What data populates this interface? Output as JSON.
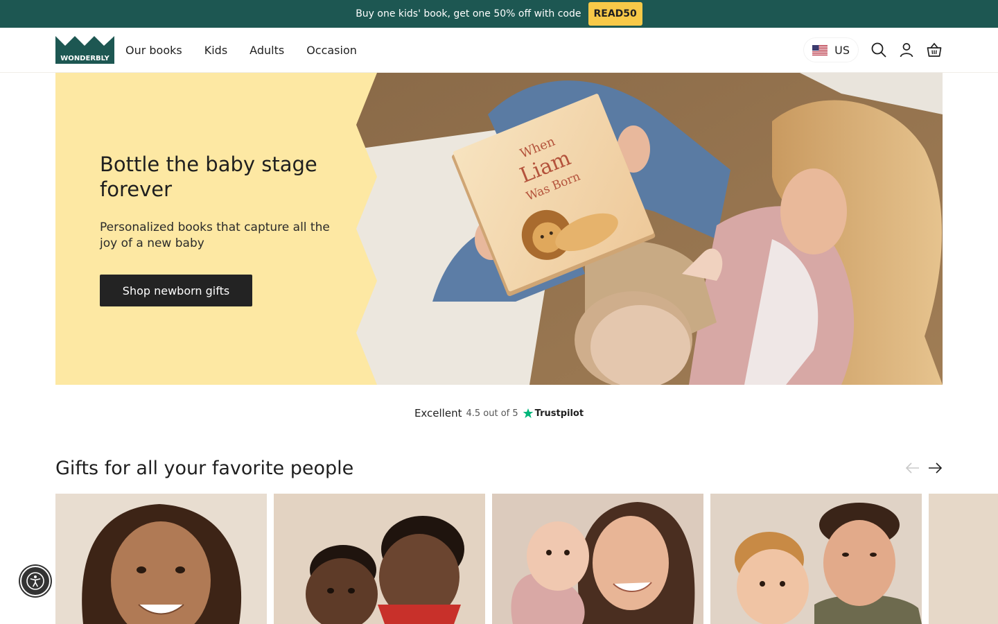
{
  "promo": {
    "text": "Buy one kids' book, get one 50% off with code",
    "code": "READ50"
  },
  "header": {
    "logo_text": "WONDERBLY",
    "nav": [
      "Our books",
      "Kids",
      "Adults",
      "Occasion"
    ],
    "locale": "US",
    "icons": [
      "search-icon",
      "account-icon",
      "basket-icon",
      "us-flag-icon"
    ]
  },
  "hero": {
    "title": "Bottle the baby stage forever",
    "subtitle": "Personalized books that capture all the joy of a new baby",
    "cta": "Shop newborn gifts",
    "book_title_lines": [
      "When",
      "Liam",
      "Was Born"
    ],
    "colors": {
      "panel": "#fde8a3",
      "button": "#232323"
    }
  },
  "trust": {
    "rating": "Excellent",
    "score": "4.5 out of 5",
    "brand": "Trustpilot"
  },
  "section": {
    "title": "Gifts for all your favorite people",
    "cards": [
      "girl-portrait",
      "two-boys-portrait",
      "mother-baby-portrait",
      "father-son-portrait"
    ]
  },
  "colors": {
    "brand_green": "#1d5752",
    "promo_code_bg": "#f7c948"
  }
}
